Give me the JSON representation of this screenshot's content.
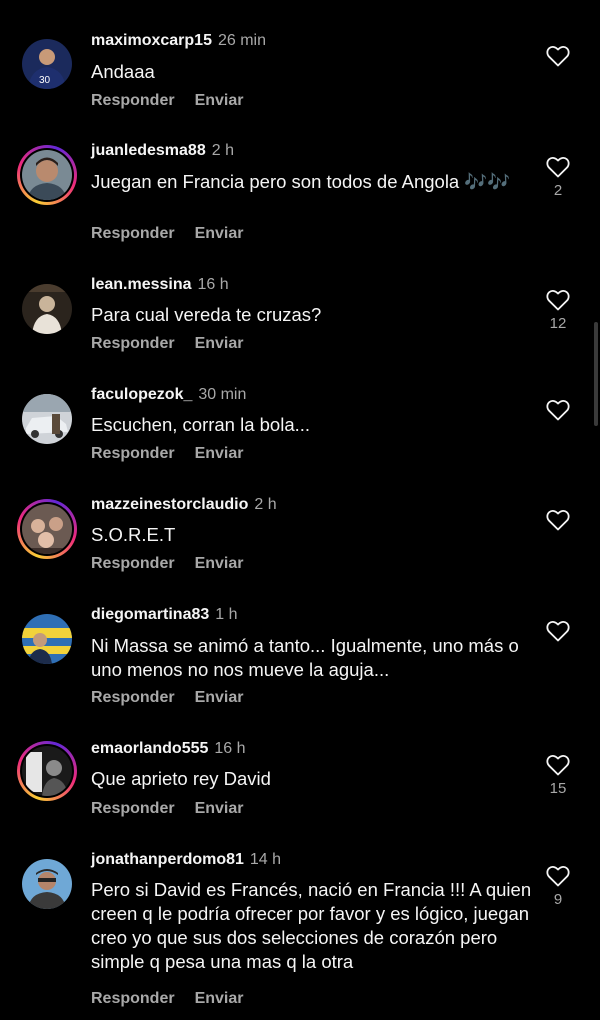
{
  "colors": {
    "background": "#000000",
    "primary_text": "#f5f5f5",
    "secondary_text": "#a8a8a8"
  },
  "actions": {
    "reply_label": "Responder",
    "send_label": "Enviar"
  },
  "comments": [
    {
      "username": "maximoxcarp15",
      "time": "26 min",
      "text": "Andaaa",
      "likes": "",
      "story_ring": false,
      "avatar_icon": "user-avatar-icon"
    },
    {
      "username": "juanledesma88",
      "time": "2 h",
      "text": "Juegan en Francia pero son todos de Angola 🎶🎶",
      "likes": "2",
      "story_ring": true,
      "avatar_icon": "user-avatar-icon"
    },
    {
      "username": "lean.messina",
      "time": "16 h",
      "text": "Para cual vereda te cruzas?",
      "likes": "12",
      "story_ring": false,
      "avatar_icon": "user-avatar-icon"
    },
    {
      "username": "faculopezok_",
      "time": "30 min",
      "text": "Escuchen, corran la bola...",
      "likes": "",
      "story_ring": false,
      "avatar_icon": "user-avatar-icon"
    },
    {
      "username": "mazzeinestorclaudio",
      "time": "2 h",
      "text": "S.O.R.E.T",
      "likes": "",
      "story_ring": true,
      "avatar_icon": "user-avatar-icon"
    },
    {
      "username": "diegomartina83",
      "time": "1 h",
      "text": "Ni Massa se animó a tanto... Igualmente, uno más o uno menos no nos mueve la aguja...",
      "likes": "",
      "story_ring": false,
      "avatar_icon": "user-avatar-icon"
    },
    {
      "username": "emaorlando555",
      "time": "16 h",
      "text": "Que aprieto rey David",
      "likes": "15",
      "story_ring": true,
      "avatar_icon": "user-avatar-icon"
    },
    {
      "username": "jonathanperdomo81",
      "time": "14 h",
      "text": "Pero si David es Francés, nació en Francia !!! A quien creen q le podría ofrecer por favor y es lógico,  juegan creo yo que sus dos selecciones de corazón pero simple q pesa una mas q la otra",
      "likes": "9",
      "story_ring": false,
      "avatar_icon": "user-avatar-icon"
    }
  ]
}
